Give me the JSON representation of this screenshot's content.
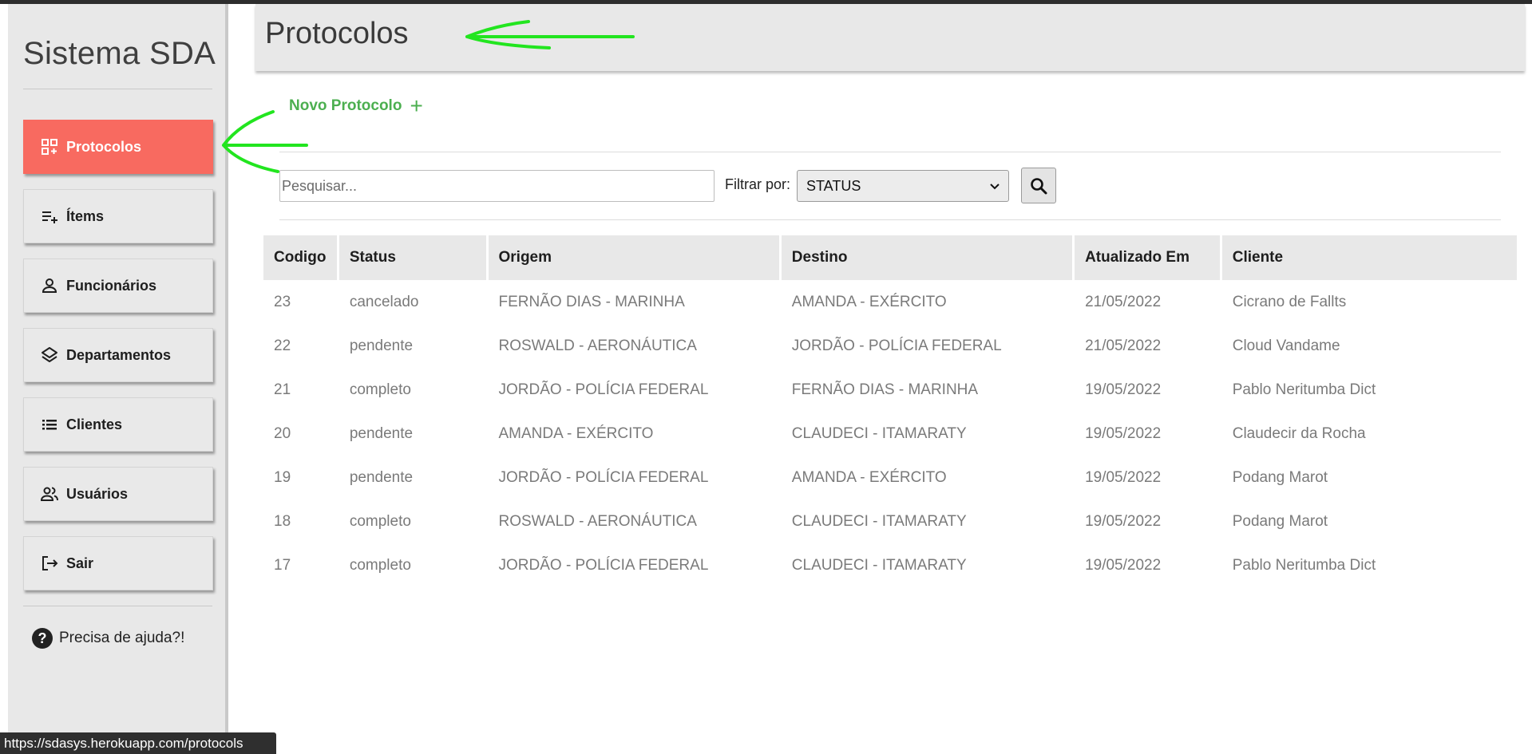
{
  "sidebar": {
    "brand": "Sistema SDA",
    "items": [
      {
        "label": "Protocolos",
        "icon": "dashboard-add-icon",
        "active": true
      },
      {
        "label": "Ítems",
        "icon": "playlist-add-icon",
        "active": false
      },
      {
        "label": "Funcionários",
        "icon": "person-icon",
        "active": false
      },
      {
        "label": "Departamentos",
        "icon": "layers-icon",
        "active": false
      },
      {
        "label": "Clientes",
        "icon": "list-icon",
        "active": false
      },
      {
        "label": "Usuários",
        "icon": "people-icon",
        "active": false
      },
      {
        "label": "Sair",
        "icon": "logout-icon",
        "active": false
      }
    ],
    "help_label": "Precisa de ajuda?!"
  },
  "header": {
    "title": "Protocolos"
  },
  "toolbar": {
    "new_label": "Novo Protocolo",
    "search_placeholder": "Pesquisar...",
    "filter_label": "Filtrar por:",
    "filter_value": "STATUS"
  },
  "table": {
    "columns": [
      "Codigo",
      "Status",
      "Origem",
      "Destino",
      "Atualizado Em",
      "Cliente"
    ],
    "rows": [
      [
        "23",
        "cancelado",
        "FERNÃO DIAS - MARINHA",
        "AMANDA - EXÉRCITO",
        "21/05/2022",
        "Cicrano de Fallts"
      ],
      [
        "22",
        "pendente",
        "ROSWALD - AERONÁUTICA",
        "JORDÃO - POLÍCIA FEDERAL",
        "21/05/2022",
        "Cloud Vandame"
      ],
      [
        "21",
        "completo",
        "JORDÃO - POLÍCIA FEDERAL",
        "FERNÃO DIAS - MARINHA",
        "19/05/2022",
        "Pablo Neritumba Dict"
      ],
      [
        "20",
        "pendente",
        "AMANDA - EXÉRCITO",
        "CLAUDECI - ITAMARATY",
        "19/05/2022",
        "Claudecir da Rocha"
      ],
      [
        "19",
        "pendente",
        "JORDÃO - POLÍCIA FEDERAL",
        "AMANDA - EXÉRCITO",
        "19/05/2022",
        "Podang Marot"
      ],
      [
        "18",
        "completo",
        "ROSWALD - AERONÁUTICA",
        "CLAUDECI - ITAMARATY",
        "19/05/2022",
        "Podang Marot"
      ],
      [
        "17",
        "completo",
        "JORDÃO - POLÍCIA FEDERAL",
        "CLAUDECI - ITAMARATY",
        "19/05/2022",
        "Pablo Neritumba Dict"
      ]
    ]
  },
  "status_url": "https://sdasys.herokuapp.com/protocols",
  "colors": {
    "active_nav": "#f86a60",
    "accent_green": "#4caf50",
    "annotation_arrow": "#22e51f"
  }
}
